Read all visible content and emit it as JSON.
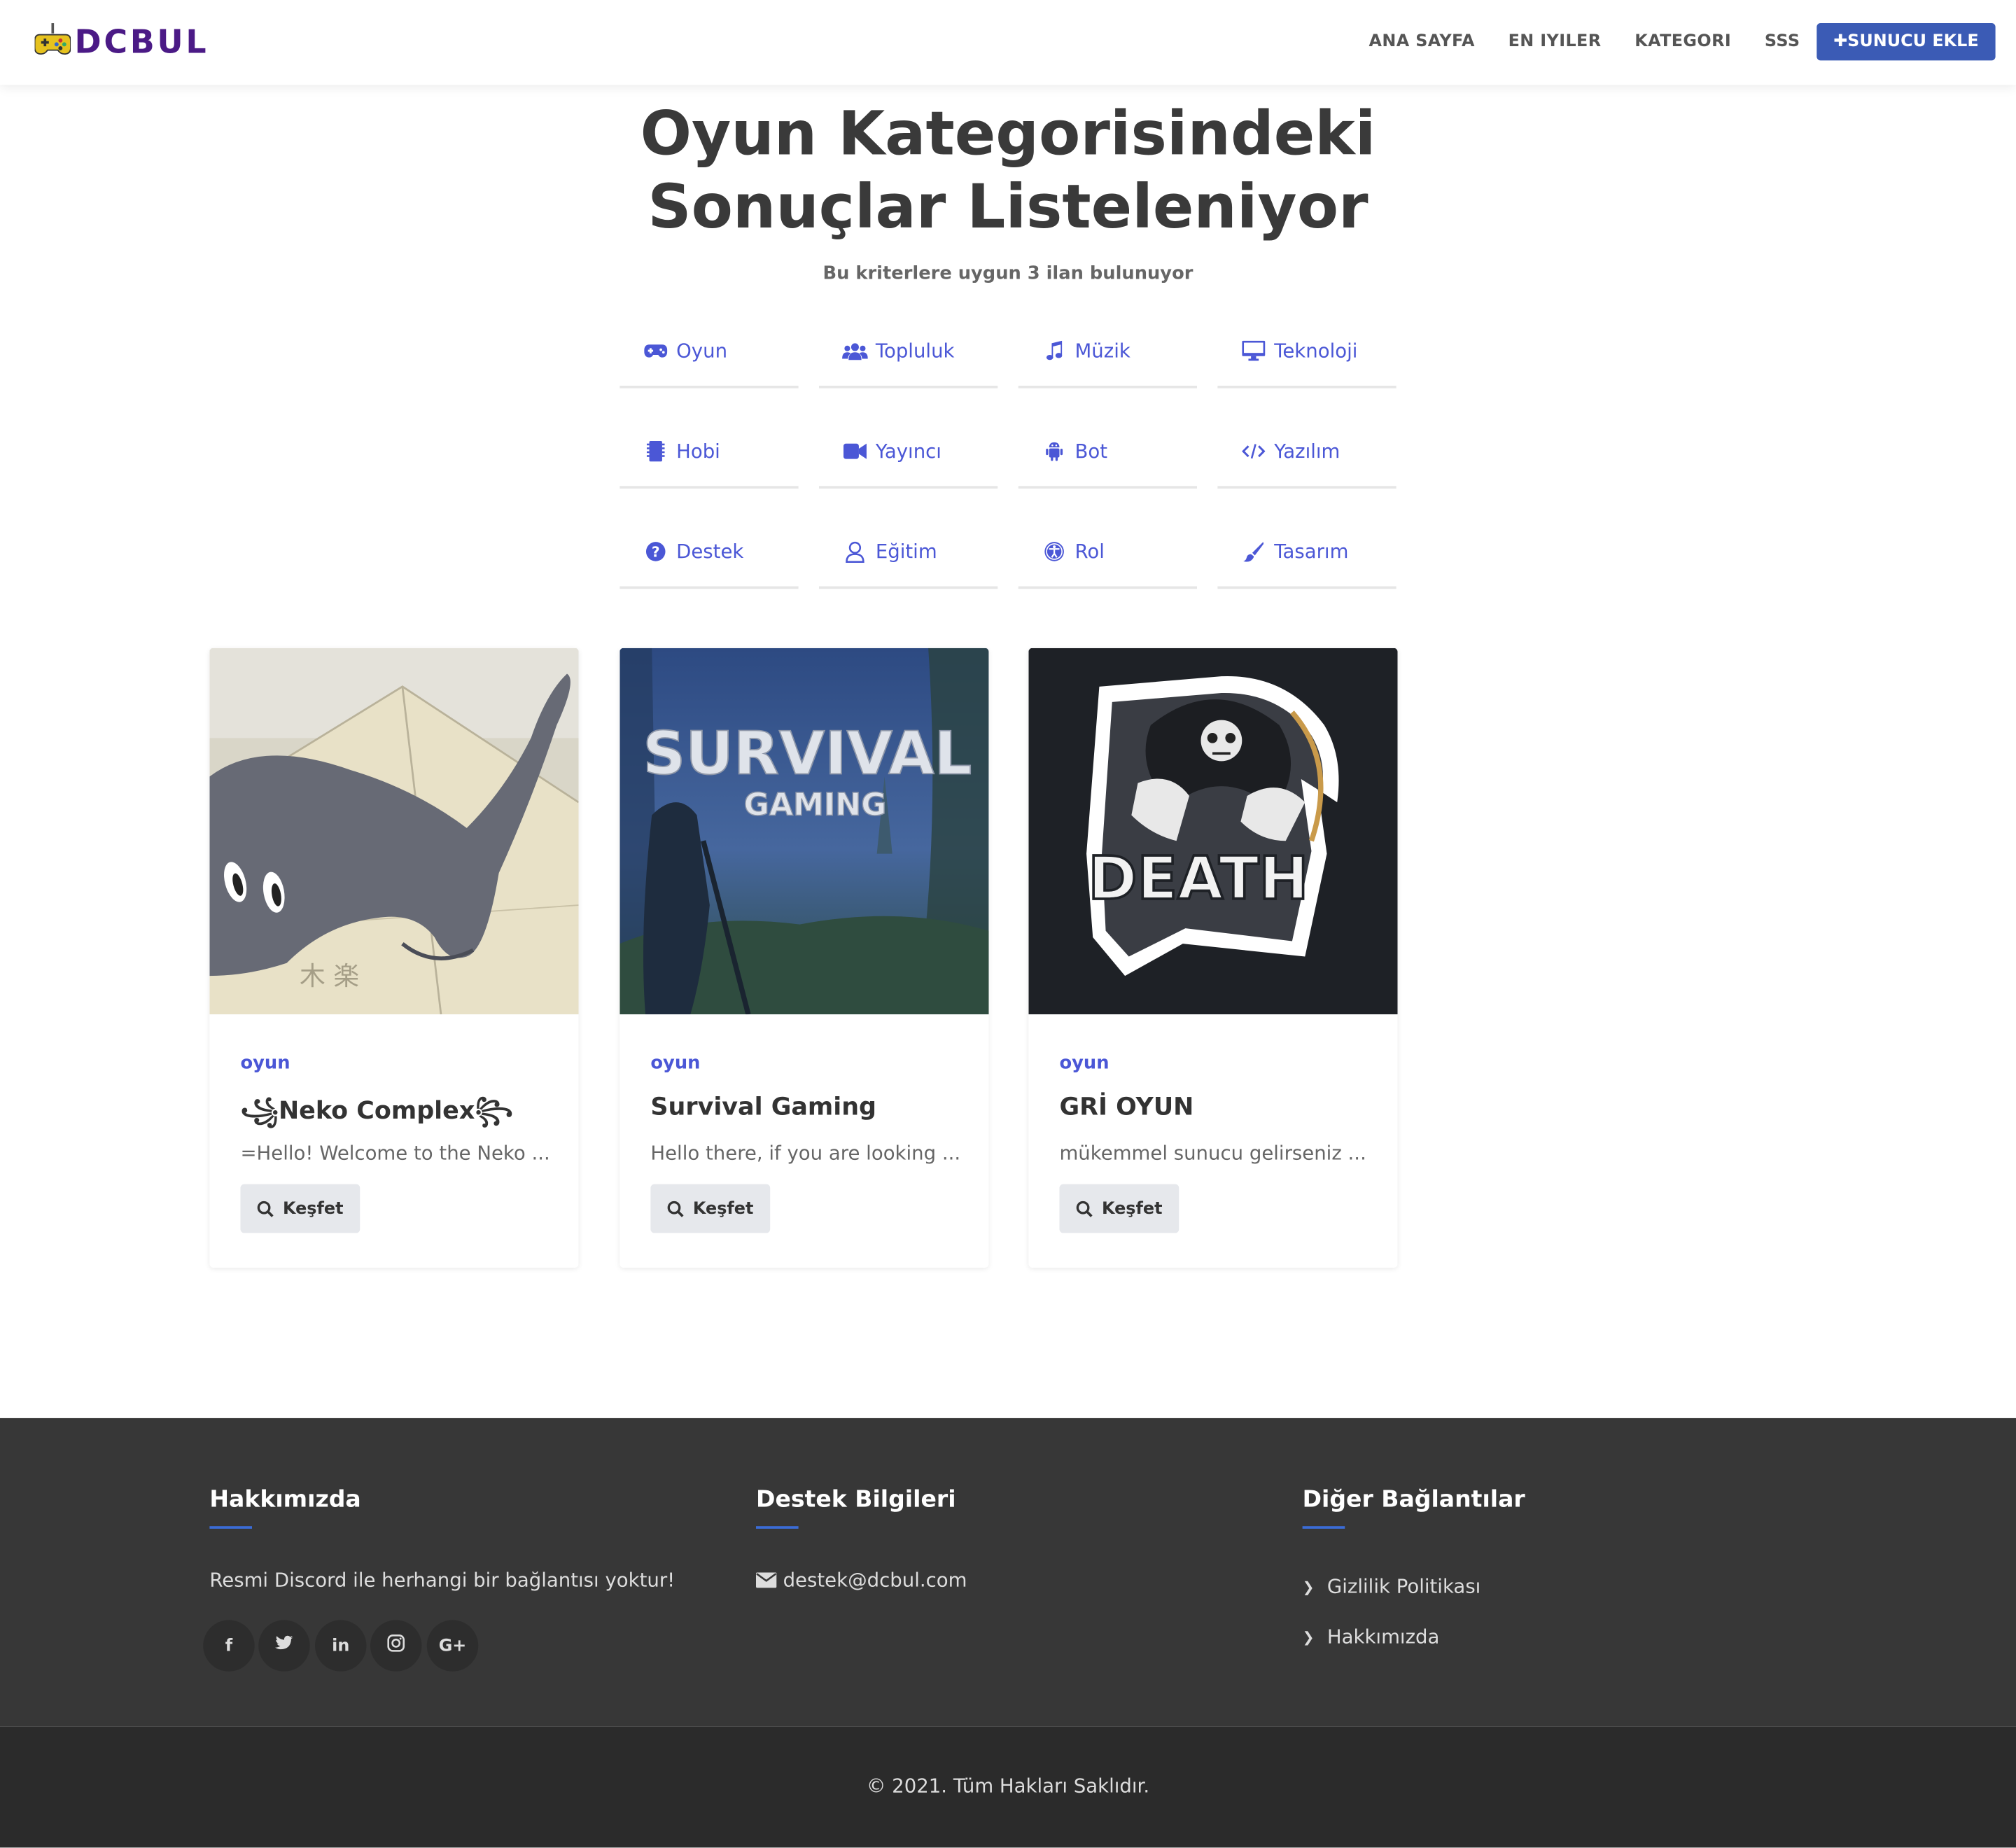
{
  "brand": {
    "name": "DCBUL",
    "logo_icon": "gamepad-icon"
  },
  "nav": {
    "items": [
      "ANA SAYFA",
      "EN IYILER",
      "KATEGORI",
      "SSS"
    ],
    "cta": "SUNUCU EKLE",
    "cta_icon": "plus-icon"
  },
  "header": {
    "title_line1": "Oyun Kategorisindeki",
    "title_line2": "Sonuçlar Listeleniyor",
    "subtitle": "Bu kriterlere uygun 3 ilan bulunuyor"
  },
  "categories": [
    {
      "label": "Oyun",
      "icon": "gamepad-icon"
    },
    {
      "label": "Topluluk",
      "icon": "users-icon"
    },
    {
      "label": "Müzik",
      "icon": "music-icon"
    },
    {
      "label": "Teknoloji",
      "icon": "desktop-icon"
    },
    {
      "label": "Hobi",
      "icon": "microchip-icon"
    },
    {
      "label": "Yayıncı",
      "icon": "video-icon"
    },
    {
      "label": "Bot",
      "icon": "android-icon"
    },
    {
      "label": "Yazılım",
      "icon": "code-icon"
    },
    {
      "label": "Destek",
      "icon": "question-circle-icon"
    },
    {
      "label": "Eğitim",
      "icon": "user-icon"
    },
    {
      "label": "Rol",
      "icon": "universal-access-icon"
    },
    {
      "label": "Tasarım",
      "icon": "paint-brush-icon"
    }
  ],
  "cards": [
    {
      "tag": "oyun",
      "title": "꧁Neko Complex꧂",
      "desc": "=Hello! Welcome to the Neko ...",
      "button": "Keşfet",
      "image": "black-cat-image"
    },
    {
      "tag": "oyun",
      "title": "Survival Gaming",
      "desc": "Hello there, if you are looking ...",
      "button": "Keşfet",
      "image": "survival-gaming-image",
      "image_text_1": "SURVIVAL",
      "image_text_2": "GAMING"
    },
    {
      "tag": "oyun",
      "title": "GRİ OYUN",
      "desc": "mükemmel sunucu gelirseniz ...",
      "button": "Keşfet",
      "image": "death-reaper-logo-image",
      "image_text": "DEATH"
    }
  ],
  "footer": {
    "about_title": "Hakkımızda",
    "about_text": "Resmi Discord ile herhangi bir bağlantısı yoktur!",
    "social": [
      "f",
      "t",
      "in",
      "ig",
      "G+"
    ],
    "support_title": "Destek Bilgileri",
    "support_email": "destek@dcbul.com",
    "links_title": "Diğer Bağlantılar",
    "links": [
      "Gizlilik Politikası",
      "Hakkımızda"
    ],
    "copyright": "© 2021. Tüm Hakları Saklıdır."
  },
  "colors": {
    "accent": "#4b57d6",
    "button": "#3b5bb5",
    "brand": "#4b1a86",
    "footer_bg": "#373737",
    "bottom_bg": "#2b2b2b"
  }
}
